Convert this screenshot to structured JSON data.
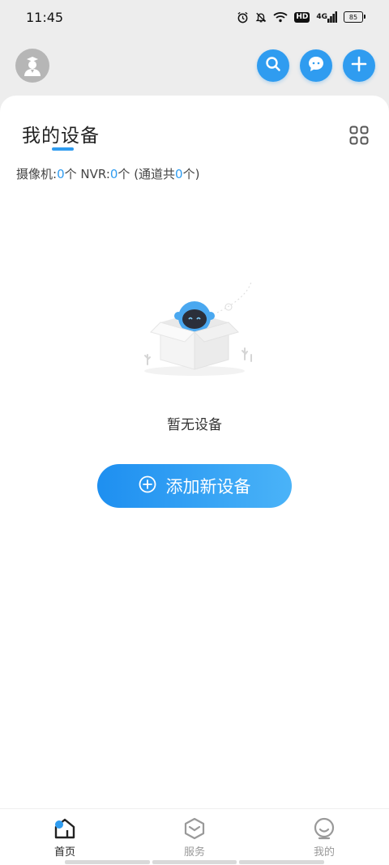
{
  "status_bar": {
    "time": "11:45",
    "network": "4G",
    "hd": "HD",
    "battery": "85",
    "icons": [
      "alarm-icon",
      "mute-bell-icon",
      "wifi-icon",
      "hd-icon",
      "signal-icon",
      "battery-icon"
    ]
  },
  "header": {
    "avatar_icon": "user-avatar-icon",
    "buttons": [
      "search-icon",
      "message-icon",
      "add-icon"
    ],
    "accent_color": "#2f9cf0"
  },
  "card": {
    "title": "我的设备",
    "grid_icon": "grid-view-icon",
    "stats": {
      "camera_label": "摄像机:",
      "camera_count": "0",
      "camera_unit": "个 NVR:",
      "nvr_count": "0",
      "nvr_unit": "个 (通道共",
      "channel_count": "0",
      "channel_unit": "个)"
    },
    "empty_text": "暂无设备",
    "add_button_label": "添加新设备"
  },
  "bottom_nav": {
    "items": [
      {
        "label": "首页",
        "icon": "home-icon",
        "active": true
      },
      {
        "label": "服务",
        "icon": "service-cube-icon",
        "active": false
      },
      {
        "label": "我的",
        "icon": "profile-face-icon",
        "active": false
      }
    ]
  }
}
